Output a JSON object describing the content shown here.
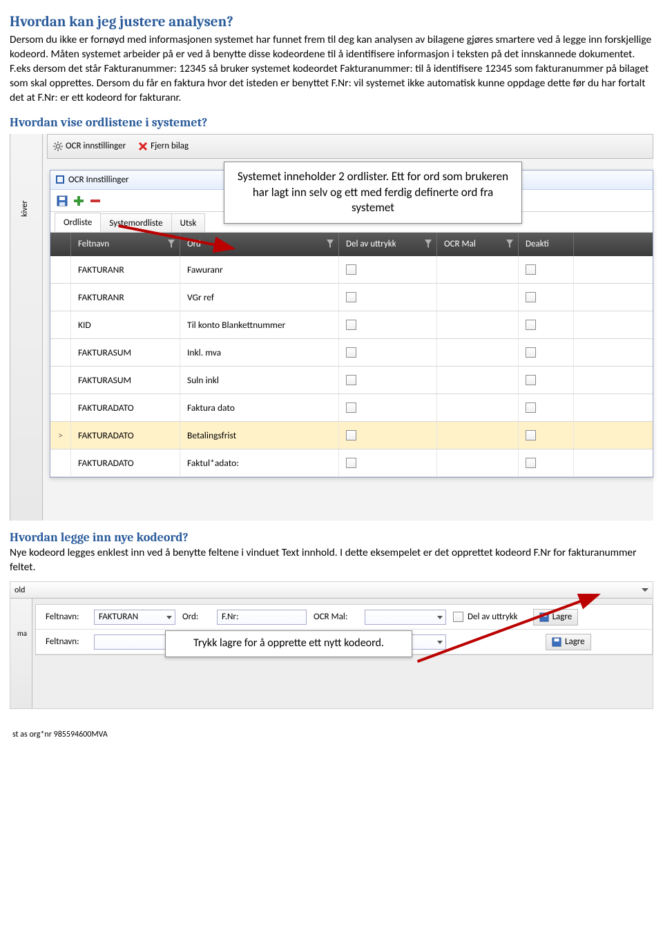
{
  "doc": {
    "h1": "Hvordan kan jeg justere analysen?",
    "p1": "Dersom du ikke er fornøyd med informasjonen systemet har funnet frem til deg kan analysen av bilagene gjøres smartere ved å legge inn forskjellige kodeord. Måten systemet arbeider på er ved å benytte disse kodeordene til å identifisere informasjon i teksten på det innskannede dokumentet. F.eks dersom det står Fakturanummer: 12345 så bruker systemet kodeordet Fakturanummer: til å identifisere 12345 som fakturanummer på bilaget som skal opprettes. Dersom du får en faktura hvor det isteden er benyttet F.Nr: vil systemet ikke automatisk kunne oppdage dette før du har fortalt det at F.Nr: er ett kodeord for fakturanr.",
    "h2": "Hvordan vise ordlistene i systemet?",
    "h3": "Hvordan legge inn nye kodeord?",
    "p3": "Nye kodeord legges enklest inn ved å benytte feltene i vinduet Text innhold. I dette eksempelet er det opprettet kodeord F.Nr for fakturanummer feltet."
  },
  "shot1": {
    "toolbar": {
      "ocr": "OCR innstillinger",
      "fjern": "Fjern bilag"
    },
    "sidetxt": "kiver",
    "dialog_title": "OCR Innstillinger",
    "tabs": [
      "Ordliste",
      "Systemordliste",
      "Utsk"
    ],
    "tooltip": "Systemet inneholder 2 ordlister. Ett for ord som brukeren har lagt inn selv og ett med ferdig definerte ord fra systemet",
    "cols": [
      "Feltnavn",
      "Ord",
      "Del av uttrykk",
      "OCR Mal",
      "Deakti"
    ],
    "rows": [
      {
        "felt": "FAKTURANR",
        "ord": "Fawuranr",
        "sel": false
      },
      {
        "felt": "FAKTURANR",
        "ord": "VGr ref",
        "sel": false
      },
      {
        "felt": "KID",
        "ord": "Til konto Blankettnummer",
        "sel": false
      },
      {
        "felt": "FAKTURASUM",
        "ord": "Inkl. mva",
        "sel": false
      },
      {
        "felt": "FAKTURASUM",
        "ord": "Suln inkl",
        "sel": false
      },
      {
        "felt": "FAKTURADATO",
        "ord": "Faktura dato",
        "sel": false
      },
      {
        "felt": "FAKTURADATO",
        "ord": "Betalingsfrist",
        "sel": true
      },
      {
        "felt": "FAKTURADATO",
        "ord": "Faktul*adato:",
        "sel": false
      }
    ]
  },
  "shot2": {
    "dropdown": "old",
    "sidetxt": "ma",
    "labels": {
      "feltnavn": "Feltnavn:",
      "ord": "Ord:",
      "ocrmal": "OCR Mal:",
      "delav": "Del av uttrykk",
      "lagre": "Lagre"
    },
    "row1": {
      "felt": "FAKTURAN",
      "ord": "F.Nr:",
      "mal": ""
    },
    "tooltip": "Trykk lagre for å opprette ett nytt kodeord."
  },
  "footer": "st as org*nr 985594600MVA"
}
